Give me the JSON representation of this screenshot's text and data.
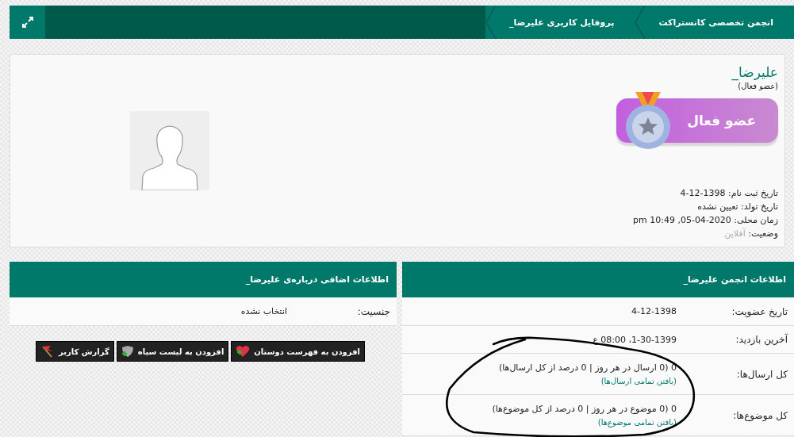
{
  "breadcrumb": {
    "items": [
      {
        "label": "انجمن تخصصی کانستراکت"
      },
      {
        "label": "پروفایل کاربری علیرضا_"
      }
    ]
  },
  "profile": {
    "username": "علیرضا_",
    "usertitle": "(عضو فعال)",
    "rank_badge": "عضو فعال",
    "details": [
      {
        "label": "تاریخ ثبت نام:",
        "value": "1398-12-4",
        "kind": "plain"
      },
      {
        "label": "تاریخ تولد:",
        "value": "تعیین نشده",
        "kind": "plain"
      },
      {
        "label": "زمان محلی:",
        "value": "2020-04-05, 10:49 pm",
        "kind": "plain"
      },
      {
        "label": "وضعیت:",
        "value": "آفلاین",
        "kind": "status"
      }
    ]
  },
  "additional_info": {
    "title": "اطلاعات اضافی درباره‌ی علیرضا_",
    "rows": [
      {
        "label": "جنسیت:",
        "value": "انتخاب نشده"
      }
    ],
    "buttons": [
      {
        "label": "افزودن به فهرست دوستان",
        "kind": "heart"
      },
      {
        "label": "افزودن به لیست سیاه",
        "kind": "shield"
      },
      {
        "label": "گزارش کاربر",
        "kind": "flag"
      }
    ]
  },
  "forum_info": {
    "title": "اطلاعات انجمن علیرضا_",
    "rows": [
      {
        "label": "تاریخ عضویت:",
        "value": "4-12-1398"
      },
      {
        "label": "آخرین بازدید:",
        "value": "1-30-1399، 08:00 ع"
      },
      {
        "label": "کل ارسال‌ها:",
        "value": "0 (0 ارسال در هر روز | 0 درصد از کل ارسال‌ها)",
        "link": "(یافتن تمامی ارسال‌ها)"
      },
      {
        "label": "کل موضوع‌ها:",
        "value": "0 (0 موضوع در هر روز | 0 درصد از کل موضوع‌ها)",
        "link": "(یافتن تمامی موضوع‌ها)"
      }
    ]
  }
}
